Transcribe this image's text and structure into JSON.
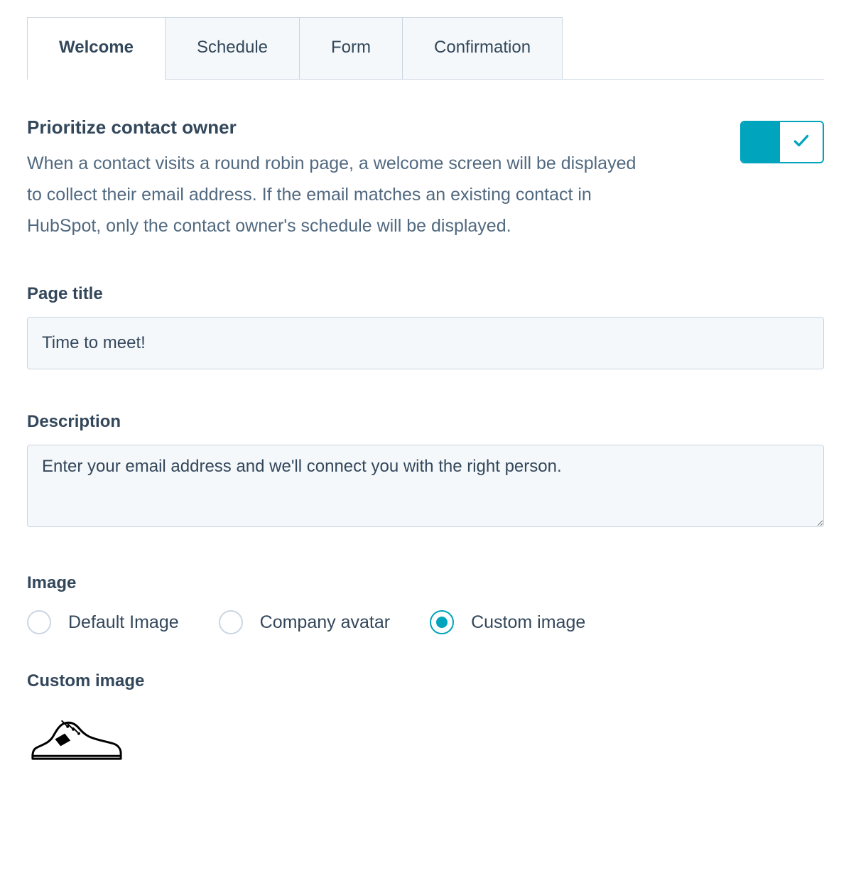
{
  "tabs": {
    "welcome": "Welcome",
    "schedule": "Schedule",
    "form": "Form",
    "confirmation": "Confirmation"
  },
  "prioritize": {
    "title": "Prioritize contact owner",
    "description": "When a contact visits a round robin page, a welcome screen will be displayed to collect their email address. If the email matches an existing contact in HubSpot, only the contact owner's schedule will be displayed.",
    "enabled": true
  },
  "page_title": {
    "label": "Page title",
    "value": "Time to meet!"
  },
  "description": {
    "label": "Description",
    "value": "Enter your email address and we'll connect you with the right person."
  },
  "image": {
    "label": "Image",
    "options": {
      "default": "Default Image",
      "company": "Company avatar",
      "custom": "Custom image"
    },
    "selected": "custom",
    "custom_label": "Custom image"
  }
}
